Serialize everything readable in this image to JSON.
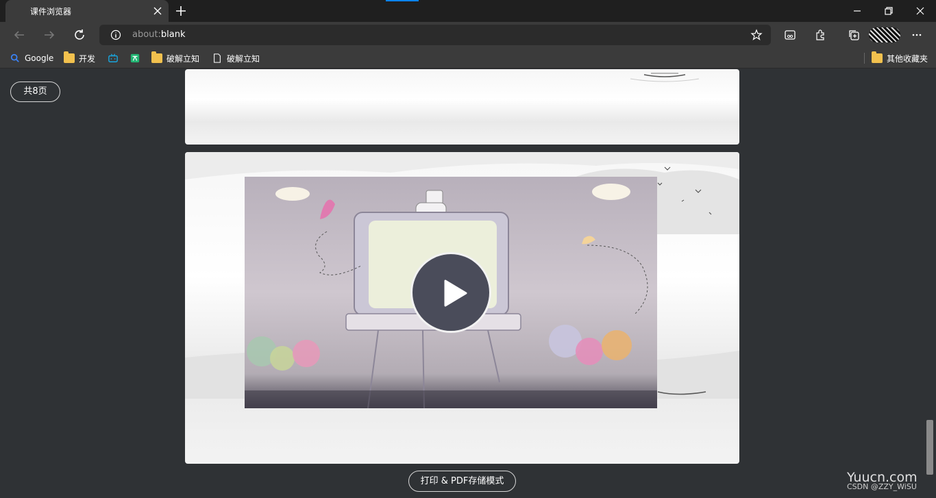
{
  "browser": {
    "tab_title": "课件浏览器",
    "address": {
      "prefix": "about:",
      "path": "blank"
    }
  },
  "bookmarks": {
    "items": [
      {
        "label": "Google",
        "icon": "search-icon"
      },
      {
        "label": "开发",
        "icon": "folder-icon"
      },
      {
        "label": "",
        "icon": "bilibili-icon"
      },
      {
        "label": "",
        "icon": "translate-icon"
      },
      {
        "label": "破解立知",
        "icon": "folder-icon"
      },
      {
        "label": "破解立知",
        "icon": "page-icon"
      }
    ],
    "other": "其他收藏夹"
  },
  "page": {
    "page_count": "共8页",
    "print_button": "打印 & PDF存储模式"
  },
  "overlay": {
    "watermark": "Yuucn.com",
    "csdn": "CSDN @ZZY_WiSU"
  },
  "colors": {
    "accent": "#0a84ff",
    "chrome": "#3b3b3b",
    "content_bg": "#2f3235"
  }
}
